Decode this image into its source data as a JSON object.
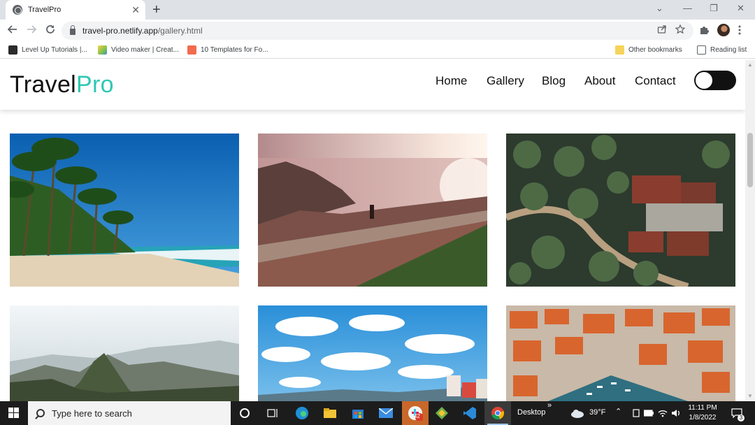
{
  "browser": {
    "tab_title": "TravelPro",
    "tab_close": "✕",
    "new_tab": "+",
    "url_host": "travel-pro.netlify.app",
    "url_path": "/gallery.html",
    "window_controls": [
      "⌄",
      "—",
      "❐",
      "✕"
    ],
    "nav_icons": [
      "arrow-left-icon",
      "arrow-right-icon",
      "reload-icon"
    ],
    "bookmarks": [
      {
        "label": "Level Up Tutorials |...",
        "color": "#2b2b2b"
      },
      {
        "label": "Video maker | Creat...",
        "color": "#7fc24a"
      },
      {
        "label": "10 Templates for Fo...",
        "color": "#f26b4f"
      }
    ],
    "other_bookmarks": "Other bookmarks",
    "reading_list": "Reading list"
  },
  "site": {
    "logo_part1": "Travel",
    "logo_part2": "Pro",
    "nav": [
      "Home",
      "Gallery",
      "Blog",
      "About",
      "Contact"
    ],
    "accent": "#2ec8b4",
    "theme_toggle": "off"
  },
  "gallery": {
    "images": [
      "tropical-beach-with-palm-trees",
      "coastal-cliff-viewpoint-at-sunset",
      "aerial-view-of-palm-trees-and-houses",
      "mountain-ruins-in-andes",
      "blue-sky-with-clouds-over-seaside-town",
      "aerial-view-of-orange-roof-harbor-town"
    ]
  },
  "taskbar": {
    "search_placeholder": "Type here to search",
    "desktop_label": "Desktop",
    "desktop_chevron": "»",
    "weather": "39°F",
    "time": "11:11 PM",
    "date": "1/8/2022",
    "notifications": "3",
    "badge": "42"
  }
}
